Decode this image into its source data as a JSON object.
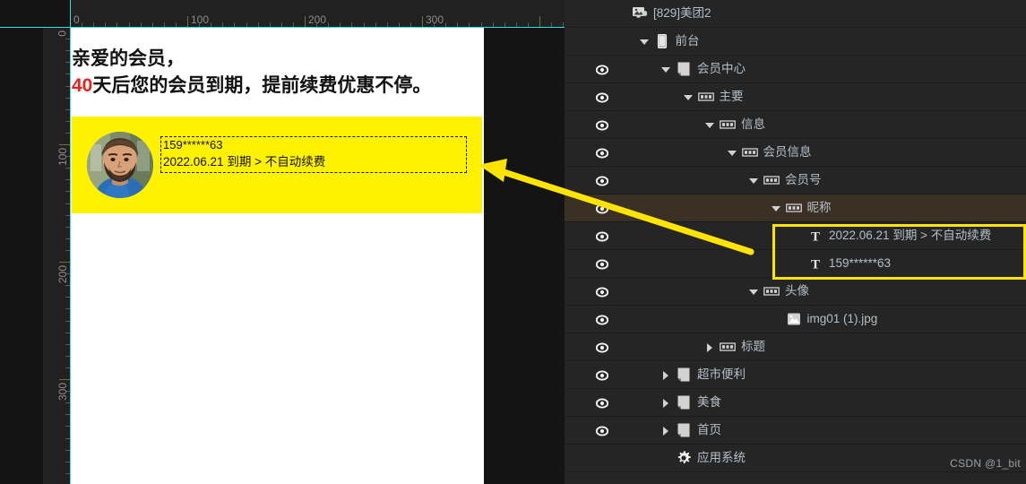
{
  "canvas": {
    "headline_line1": "亲爱的会员，",
    "headline_number": "40",
    "headline_line2_rest": "天后您的会员到期，提前续费优惠不停。",
    "card": {
      "member_id": "159******63",
      "expiry_text": "2022.06.21 到期 > 不自动续费"
    },
    "colors": {
      "card_background": "#fff200",
      "highlight_number": "#e8231a",
      "guide_line": "#2fe3e3"
    }
  },
  "ruler": {
    "horizontal_labels": [
      "0",
      "100",
      "200",
      "300"
    ],
    "vertical_labels": [
      "0",
      "100",
      "200",
      "300"
    ]
  },
  "tree": {
    "rows": [
      {
        "label": "[829]美团2",
        "icon": "monitor-icon",
        "caret": "none",
        "eye": false,
        "indent": 0,
        "selected": false
      },
      {
        "label": "前台",
        "icon": "phone-icon",
        "caret": "down",
        "eye": false,
        "indent": 1,
        "selected": false
      },
      {
        "label": "会员中心",
        "icon": "page-icon",
        "caret": "down",
        "eye": true,
        "indent": 2,
        "selected": false
      },
      {
        "label": "主要",
        "icon": "group-icon",
        "caret": "down",
        "eye": true,
        "indent": 3,
        "selected": false
      },
      {
        "label": "信息",
        "icon": "group-icon",
        "caret": "down",
        "eye": true,
        "indent": 4,
        "selected": false
      },
      {
        "label": "会员信息",
        "icon": "group-icon",
        "caret": "down",
        "eye": true,
        "indent": 5,
        "selected": false
      },
      {
        "label": "会员号",
        "icon": "group-icon",
        "caret": "down",
        "eye": true,
        "indent": 6,
        "selected": false
      },
      {
        "label": "昵称",
        "icon": "group-icon",
        "caret": "down",
        "eye": true,
        "indent": 7,
        "selected": true
      },
      {
        "label": "2022.06.21 到期 > 不自动续费",
        "icon": "text-icon",
        "caret": "none",
        "eye": true,
        "indent": 8,
        "selected": false
      },
      {
        "label": "159******63",
        "icon": "text-icon",
        "caret": "none",
        "eye": true,
        "indent": 8,
        "selected": false
      },
      {
        "label": "头像",
        "icon": "group-icon",
        "caret": "down",
        "eye": true,
        "indent": 6,
        "selected": false
      },
      {
        "label": "img01 (1).jpg",
        "icon": "image-icon",
        "caret": "none",
        "eye": true,
        "indent": 7,
        "selected": false
      },
      {
        "label": "标题",
        "icon": "group-icon",
        "caret": "right",
        "eye": true,
        "indent": 4,
        "selected": false
      },
      {
        "label": "超市便利",
        "icon": "page-icon",
        "caret": "right",
        "eye": true,
        "indent": 2,
        "selected": false
      },
      {
        "label": "美食",
        "icon": "page-icon",
        "caret": "right",
        "eye": true,
        "indent": 2,
        "selected": false
      },
      {
        "label": "首页",
        "icon": "page-icon",
        "caret": "right",
        "eye": true,
        "indent": 2,
        "selected": false
      },
      {
        "label": "应用系统",
        "icon": "gear-icon",
        "caret": "none",
        "eye": false,
        "indent": 2,
        "selected": false
      }
    ],
    "colors": {
      "background": "#252525",
      "selected_row": "#3a3023",
      "text": "#b5bfc9",
      "highlight_border": "#ffe400"
    }
  },
  "annotation": {
    "arrow_color": "#ffe400",
    "watermark": "CSDN @1_bit"
  }
}
